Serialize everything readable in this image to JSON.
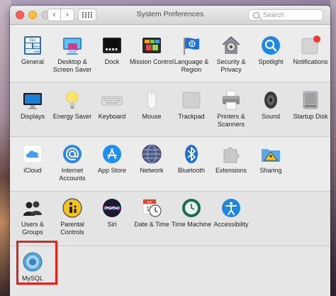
{
  "window": {
    "title": "System Preferences"
  },
  "search": {
    "placeholder": "Search"
  },
  "rows": [
    [
      {
        "id": "general",
        "label": "General"
      },
      {
        "id": "desktop",
        "label": "Desktop & Screen Saver"
      },
      {
        "id": "dock",
        "label": "Dock"
      },
      {
        "id": "mission",
        "label": "Mission Control"
      },
      {
        "id": "language",
        "label": "Language & Region"
      },
      {
        "id": "security",
        "label": "Security & Privacy"
      },
      {
        "id": "spotlight",
        "label": "Spotlight"
      },
      {
        "id": "notifications",
        "label": "Notifications"
      }
    ],
    [
      {
        "id": "displays",
        "label": "Displays"
      },
      {
        "id": "energy",
        "label": "Energy Saver"
      },
      {
        "id": "keyboard",
        "label": "Keyboard"
      },
      {
        "id": "mouse",
        "label": "Mouse"
      },
      {
        "id": "trackpad",
        "label": "Trackpad"
      },
      {
        "id": "printers",
        "label": "Printers & Scanners"
      },
      {
        "id": "sound",
        "label": "Sound"
      },
      {
        "id": "startup",
        "label": "Startup Disk"
      }
    ],
    [
      {
        "id": "icloud",
        "label": "iCloud"
      },
      {
        "id": "internet",
        "label": "Internet Accounts"
      },
      {
        "id": "appstore",
        "label": "App Store"
      },
      {
        "id": "network",
        "label": "Network"
      },
      {
        "id": "bluetooth",
        "label": "Bluetooth"
      },
      {
        "id": "extensions",
        "label": "Extensions"
      },
      {
        "id": "sharing",
        "label": "Sharing"
      }
    ],
    [
      {
        "id": "users",
        "label": "Users & Groups"
      },
      {
        "id": "parental",
        "label": "Parental Controls"
      },
      {
        "id": "siri",
        "label": "Siri"
      },
      {
        "id": "datetime",
        "label": "Date & Time"
      },
      {
        "id": "timemachine",
        "label": "Time Machine"
      },
      {
        "id": "accessibility",
        "label": "Accessibility"
      }
    ],
    [
      {
        "id": "mysql",
        "label": "MySQL"
      }
    ]
  ],
  "icon_text": {
    "general_file": "File",
    "general_new": "New",
    "general_one": "One",
    "calendar_month": "JUL",
    "calendar_day": "17"
  },
  "colors": {
    "highlight": "#e0241b",
    "accent": "#1a7ef5"
  }
}
